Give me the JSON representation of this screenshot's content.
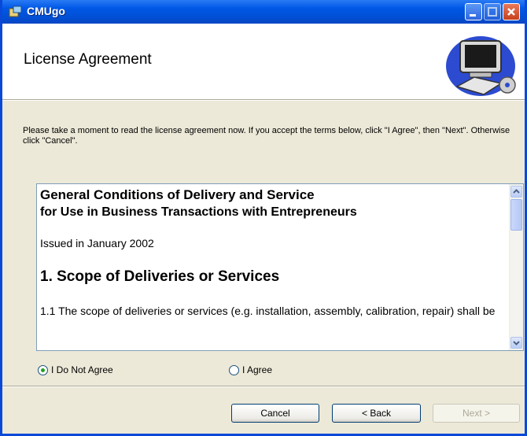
{
  "window": {
    "title": "CMUgo"
  },
  "banner": {
    "title": "License Agreement"
  },
  "instructions": "Please take a moment to read the license agreement now. If you accept the terms below, click \"I Agree\", then \"Next\". Otherwise click \"Cancel\".",
  "license": {
    "heading_line1": "General Conditions of Delivery and Service",
    "heading_line2": "for Use in Business Transactions with Entrepreneurs",
    "issued": "Issued in January 2002",
    "section1_title": "1. Scope of Deliveries or Services",
    "section1_text": "1.1 The scope of deliveries or services (e.g. installation, assembly, calibration, repair) shall be"
  },
  "options": {
    "do_not_agree": {
      "label": "I Do Not Agree",
      "selected": true
    },
    "agree": {
      "label": "I Agree",
      "selected": false
    }
  },
  "buttons": {
    "cancel": "Cancel",
    "back": "< Back",
    "next": "Next >"
  },
  "colors": {
    "titlebar": "#0058e6",
    "dialog_bg": "#ece9d8",
    "accent": "#21a121"
  }
}
